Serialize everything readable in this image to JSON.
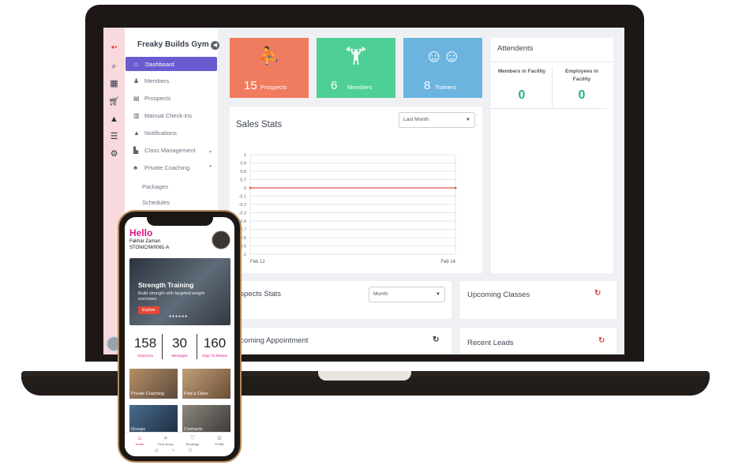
{
  "sidebar": {
    "title": "Freaky Builds Gym",
    "items": [
      {
        "label": "Dashboard",
        "icon": "home-icon"
      },
      {
        "label": "Members",
        "icon": "member-icon"
      },
      {
        "label": "Prospects",
        "icon": "prospect-icon"
      },
      {
        "label": "Manual Check-ins",
        "icon": "checkin-icon"
      },
      {
        "label": "Notifications",
        "icon": "bell-icon"
      },
      {
        "label": "Class Management",
        "icon": "class-icon"
      },
      {
        "label": "Private Coaching",
        "icon": "coaching-icon"
      }
    ],
    "sub_items": [
      "Packages",
      "Schedules"
    ]
  },
  "tiles": [
    {
      "value": "15",
      "label": "Prospects",
      "color": "#ef7c5f"
    },
    {
      "value": "6",
      "label": "Members",
      "color": "#4ecf95"
    },
    {
      "value": "8",
      "label": "Trainers",
      "color": "#6cb4e0"
    }
  ],
  "attendents": {
    "title": "Attendents",
    "members_label": "Members in Facility",
    "members_value": "0",
    "employees_label": "Employees in Facility",
    "employees_value": "0"
  },
  "sales": {
    "title": "Sales Stats",
    "filter": "Last Month"
  },
  "chart_data": {
    "type": "line",
    "x": [
      "Feb 12",
      "Feb 14"
    ],
    "series": [
      {
        "values": [
          0,
          0
        ]
      }
    ],
    "y_ticks": [
      "1",
      "0.9",
      "0.8",
      "0.7",
      "0",
      "-0.1",
      "-0.2",
      "-0.3",
      "-0.4",
      "-0.7",
      "-0.8",
      "-0.9",
      "-1"
    ],
    "ylim": [
      -1,
      1
    ],
    "grid": true,
    "line_color": "#d9534f"
  },
  "prospects_stats": {
    "title": "ospects Stats",
    "filter": "Month"
  },
  "upcoming_classes": {
    "title": "Upcoming Classes"
  },
  "upcoming_appointment": {
    "title": "pcoming Appointment"
  },
  "recent_leads": {
    "title": "Recent Leads"
  },
  "phone": {
    "greeting": "Hello",
    "name": "Fakhar Zaman",
    "member_id": "STONIC/M/0061-A",
    "banner_title": "Strength Training",
    "banner_text": "Build strength with targeted weight exercises",
    "explore": "Explore",
    "stats": [
      {
        "value": "158",
        "label": "Check-ins"
      },
      {
        "value": "30",
        "label": "Messages"
      },
      {
        "value": "160",
        "label": "Days To Renew"
      }
    ],
    "grid": [
      "Private Coaching",
      "Find a Class",
      "Groups",
      "Contracts"
    ],
    "nav": [
      "Home",
      "Find Gross",
      "Bookings",
      "Profile"
    ],
    "accent": "#e0148c"
  }
}
